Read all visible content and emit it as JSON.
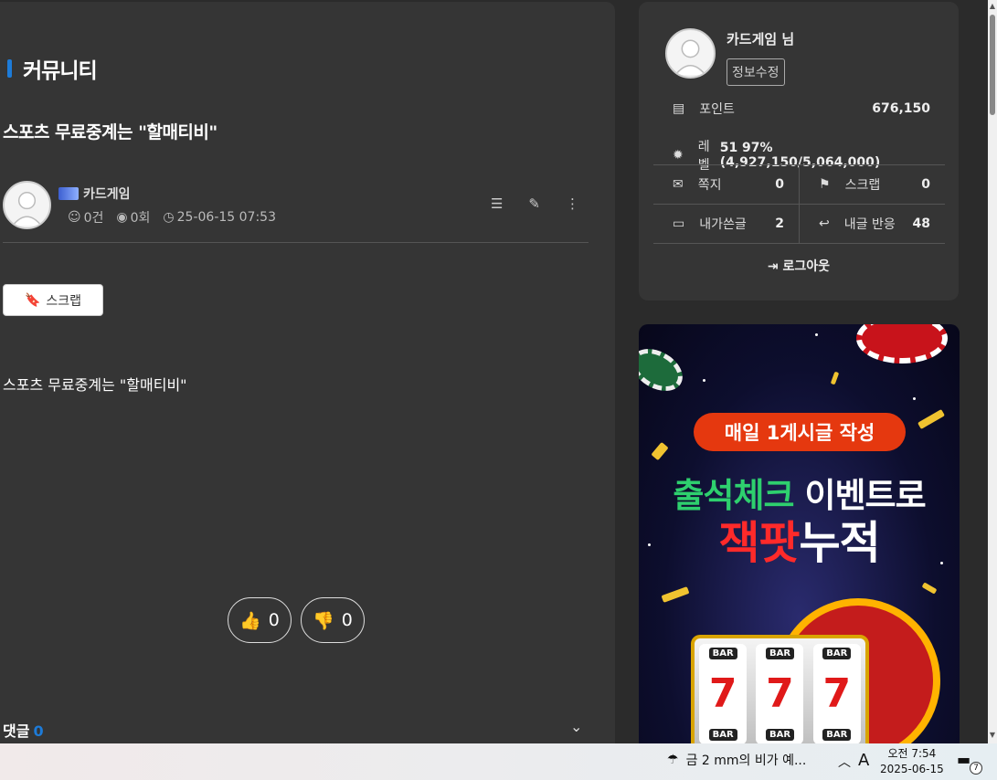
{
  "section": {
    "title": "커뮤니티"
  },
  "post": {
    "title": "스포츠 무료중계는 \"할매티비\"",
    "author": "카드게임",
    "comment_count": "0건",
    "view_count": "0회",
    "datetime": "25-06-15 07:53",
    "scrap_label": "스크랩",
    "body": "스포츠 무료중계는 \"할매티비\"",
    "likes": "0",
    "dislikes": "0"
  },
  "comments": {
    "label": "댓글",
    "count": "0"
  },
  "member": {
    "name": "카드게임 님",
    "edit_label": "정보수정",
    "point_label": "포인트",
    "point_value": "676,150",
    "level_label": "레벨",
    "level_value": "51 97% (4,927,150/5,064,000)",
    "memo_label": "쪽지",
    "memo_value": "0",
    "scrap_label": "스크랩",
    "scrap_value": "0",
    "mypost_label": "내가쓴글",
    "mypost_value": "2",
    "reply_label": "내글 반응",
    "reply_value": "48",
    "logout_label": "로그아웃"
  },
  "ad": {
    "pill": "매일 1게시글 작성",
    "line1_green": "출석체크",
    "line1_white": " 이벤트로",
    "line2_red": "잭팟",
    "line2_white": "누적",
    "reel_bar": "BAR",
    "reel_seven": "7"
  },
  "taskbar": {
    "weather": "금 2 mm의 비가 예...",
    "ime": "A",
    "time": "오전 7:54",
    "date": "2025-06-15",
    "notifications": "7"
  },
  "colors": {
    "accent": "#1d7bd8",
    "panel": "#353535",
    "background": "#2b2b2b"
  }
}
